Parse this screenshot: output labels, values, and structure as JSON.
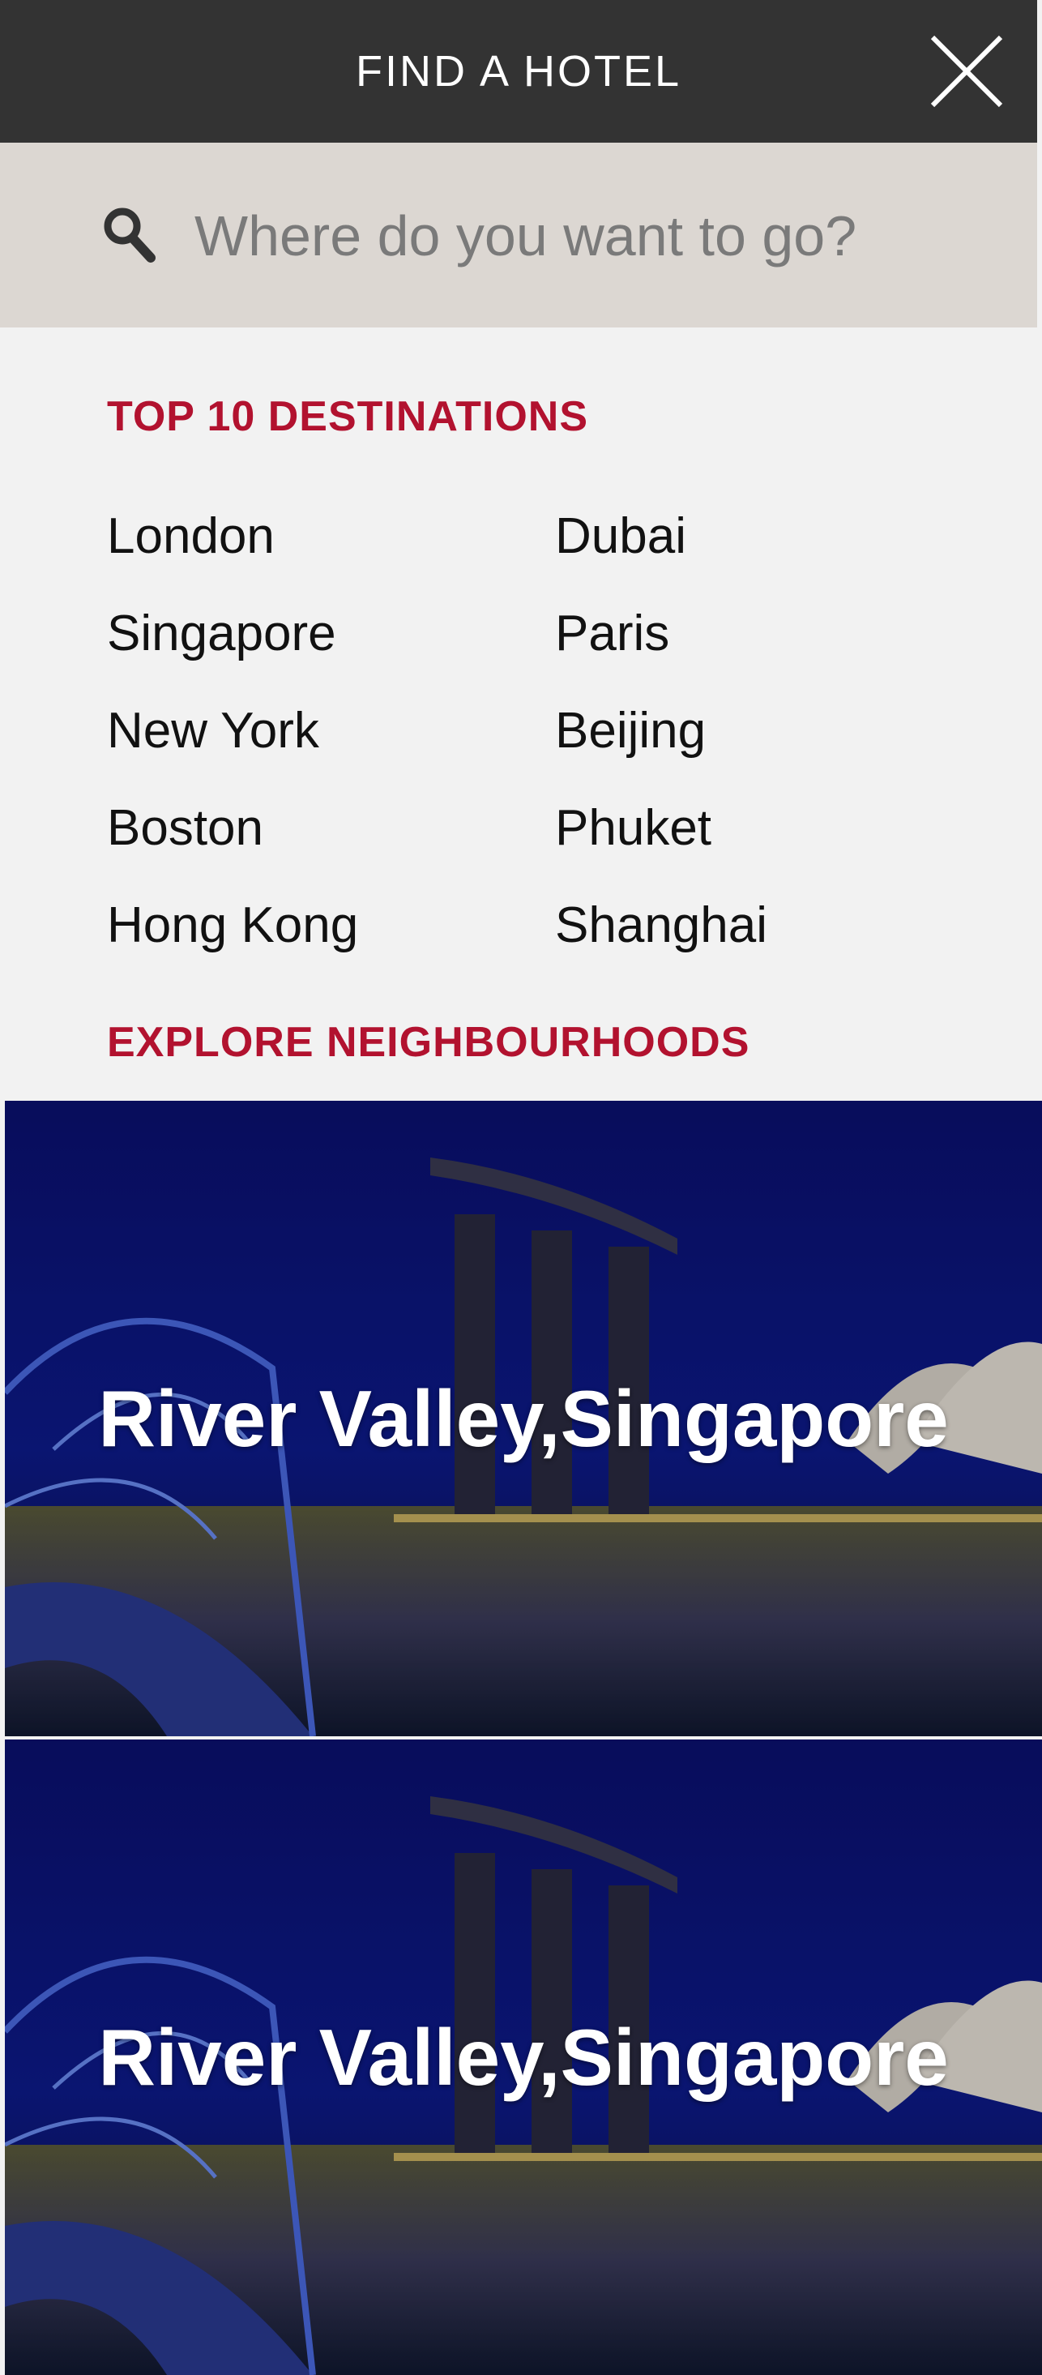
{
  "header": {
    "title": "FIND A HOTEL",
    "close_icon": "close-icon"
  },
  "search": {
    "placeholder": "Where do you want to go?",
    "value": "",
    "icon": "search-icon"
  },
  "top_destinations": {
    "heading": "TOP 10 DESTINATIONS",
    "column_1": [
      "London",
      "Singapore",
      "New York",
      "Boston",
      "Hong Kong"
    ],
    "column_2": [
      "Dubai",
      "Paris",
      "Beijing",
      "Phuket",
      "Shanghai"
    ]
  },
  "neighbourhoods": {
    "heading": "EXPLORE NEIGHBOURHOODS",
    "cards": [
      {
        "line1": "River Valley,",
        "line2": "Singapore"
      },
      {
        "line1": "River Valley,",
        "line2": "Singapore"
      }
    ]
  },
  "colors": {
    "header_bg": "#333333",
    "search_bg": "#dcd7d2",
    "accent_red": "#b2122f",
    "page_bg": "#f2f2f2"
  }
}
